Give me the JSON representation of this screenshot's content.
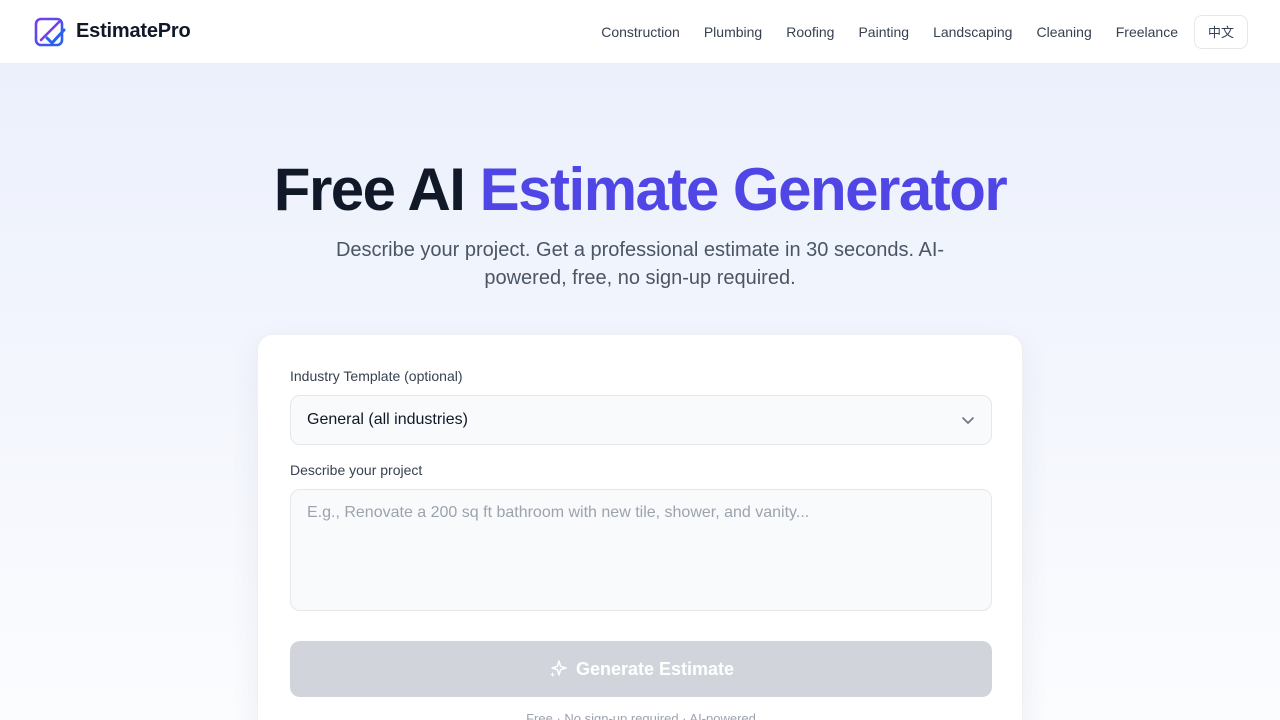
{
  "brand": {
    "name": "EstimatePro",
    "logo_icon": "checkbox-pencil-logo"
  },
  "nav": {
    "links": [
      "Construction",
      "Plumbing",
      "Roofing",
      "Painting",
      "Landscaping",
      "Cleaning",
      "Freelance"
    ],
    "language_button": "中文"
  },
  "hero": {
    "title_plain": "Free AI ",
    "title_accent": "Estimate Generator",
    "subtitle": "Describe your project. Get a professional estimate in 30 seconds. AI-powered, free, no sign-up required."
  },
  "form": {
    "industry_label": "Industry Template (optional)",
    "industry_value": "General (all industries)",
    "describe_label": "Describe your project",
    "describe_placeholder": "E.g., Renovate a 200 sq ft bathroom with new tile, shower, and vanity...",
    "describe_value": "",
    "generate_button": "Generate Estimate",
    "generate_icon": "sparkles-icon",
    "footnote": "Free · No sign-up required · AI-powered"
  },
  "colors": {
    "accent": "#4f46e5",
    "button_disabled": "#d1d5db",
    "text_primary": "#111827",
    "text_secondary": "#4b5563"
  }
}
